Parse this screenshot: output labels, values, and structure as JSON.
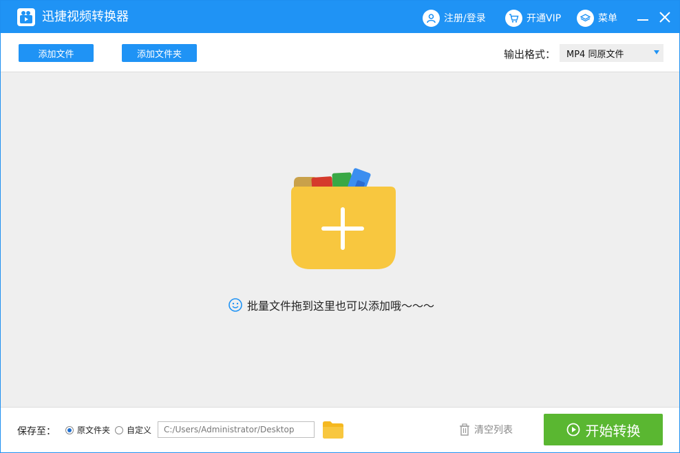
{
  "titlebar": {
    "app_title": "迅捷视频转换器",
    "login_label": "注册/登录",
    "vip_label": "开通VIP",
    "menu_label": "菜单"
  },
  "toolbar": {
    "add_file_label": "添加文件",
    "add_folder_label": "添加文件夹",
    "output_format_label": "输出格式：",
    "output_format_value": "MP4  同原文件"
  },
  "drop_area": {
    "hint": "批量文件拖到这里也可以添加哦～～～"
  },
  "bottom": {
    "save_to_label": "保存至：",
    "option_original": "原文件夹",
    "option_custom": "自定义",
    "selected_option": "原文件夹",
    "path_value": "C:/Users/Administrator/Desktop",
    "clear_list_label": "清空列表",
    "start_label": "开始转换"
  },
  "colors": {
    "accent": "#1f93f5",
    "start": "#5ab731",
    "folder": "#f8c73f"
  }
}
